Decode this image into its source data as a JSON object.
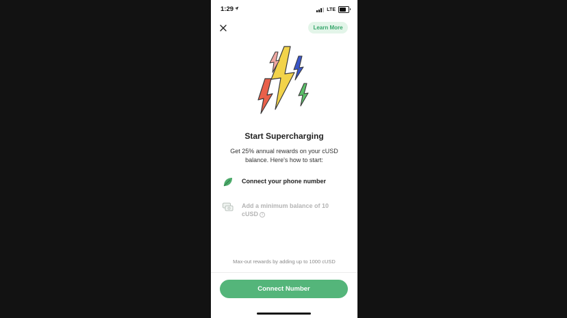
{
  "status_bar": {
    "time": "1:29",
    "network": "LTE",
    "location_icon": "location-arrow-icon",
    "signal_icon": "signal-bars-icon",
    "battery_icon": "battery-icon"
  },
  "header": {
    "close_icon": "close-icon",
    "learn_more_label": "Learn More"
  },
  "hero": {
    "icon": "lightning-bolts-icon",
    "colors": [
      "#f2d34a",
      "#e9604a",
      "#3a56c8",
      "#5cbf6a",
      "#efa8a2"
    ]
  },
  "content": {
    "title": "Start Supercharging",
    "subtitle": "Get 25% annual rewards on your cUSD balance. Here's how to start:",
    "steps": [
      {
        "icon": "leaf-icon",
        "label": "Connect your phone number",
        "state": "active"
      },
      {
        "icon": "cash-stack-icon",
        "label": "Add a minimum balance of 10 cUSD",
        "state": "inactive",
        "info_icon": "info-icon"
      }
    ]
  },
  "footer": {
    "note": "Max-out rewards by adding up to 1000 cUSD",
    "primary_button_label": "Connect Number",
    "accent_color": "#54b57a"
  }
}
